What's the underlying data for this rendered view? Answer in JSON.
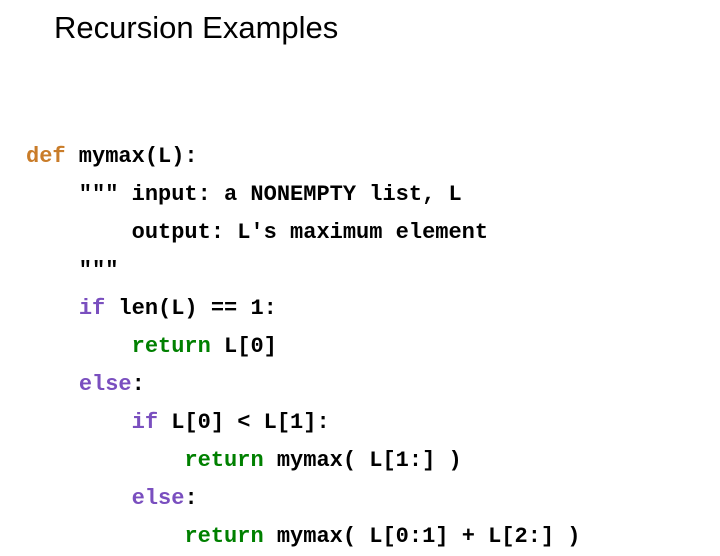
{
  "title": "Recursion Examples",
  "code": {
    "l1": {
      "def": "def",
      "rest": " mymax(L):"
    },
    "l2": "    \"\"\" input: a NONEMPTY list, L",
    "l3": "        output: L's maximum element",
    "l4": "    \"\"\"",
    "l5": {
      "indent": "    ",
      "kw": "if",
      "rest": " len(L) == 1:"
    },
    "l6": {
      "indent": "        ",
      "kw": "return",
      "rest": " L[0]"
    },
    "l7": {
      "indent": "    ",
      "kw": "else",
      "rest": ":"
    },
    "l8": {
      "indent": "        ",
      "kw": "if",
      "rest": " L[0] < L[1]:"
    },
    "l9": {
      "indent": "            ",
      "kw": "return",
      "rest": " mymax( L[1:] )"
    },
    "l10": {
      "indent": "        ",
      "kw": "else",
      "rest": ":"
    },
    "l11": {
      "indent": "            ",
      "kw": "return",
      "rest": " mymax( L[0:1] + L[2:] )"
    }
  }
}
